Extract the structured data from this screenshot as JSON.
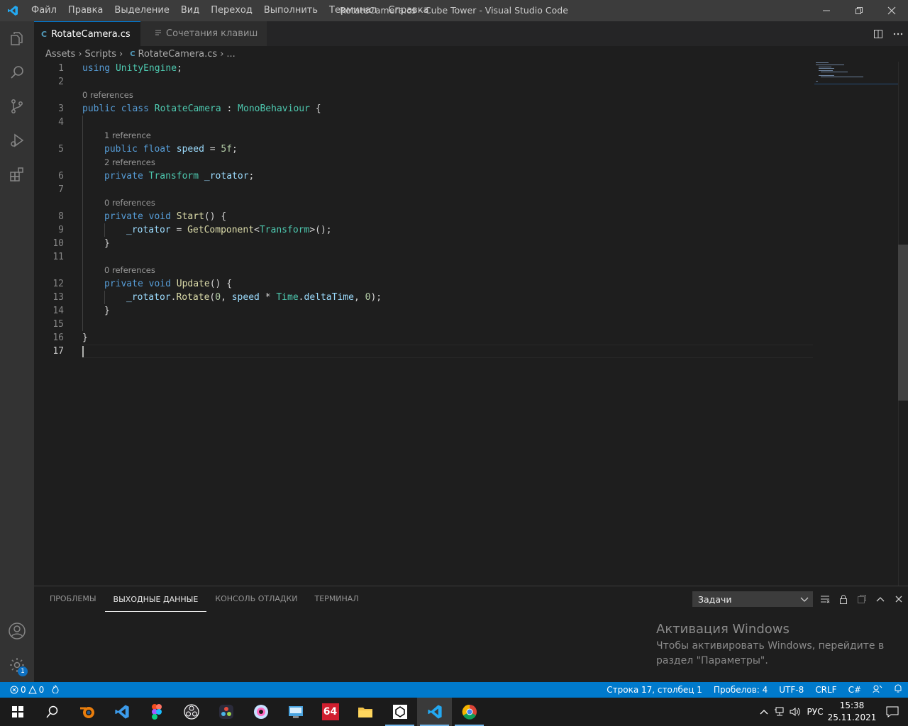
{
  "titlebar": {
    "menu": [
      "Файл",
      "Правка",
      "Выделение",
      "Вид",
      "Переход",
      "Выполнить",
      "Терминал",
      "Справка"
    ],
    "title": "RotateCamera.cs - Cube Tower - Visual Studio Code"
  },
  "tabs": [
    {
      "label": "RotateCamera.cs",
      "icon": "csharp-icon",
      "active": true
    },
    {
      "label": "Сочетания клавиш",
      "icon": "keyboard-shortcuts-icon",
      "active": false
    }
  ],
  "breadcrumb": {
    "items": [
      "Assets",
      "Scripts",
      "RotateCamera.cs",
      "..."
    ]
  },
  "editor": {
    "current_line": "17",
    "line_numbers": [
      "1",
      "2",
      "3",
      "4",
      "5",
      "6",
      "7",
      "8",
      "9",
      "10",
      "11",
      "12",
      "13",
      "14",
      "15",
      "16",
      "17"
    ],
    "codelens": {
      "class": "0 references",
      "speed": "1 reference",
      "rotator": "2 references",
      "start": "0 references",
      "update": "0 references"
    },
    "tokens": {
      "using": "using",
      "unity_engine": "UnityEngine",
      "semi": ";",
      "public": "public",
      "class": "class",
      "rotate_camera": "RotateCamera",
      "colon": " : ",
      "mono": "MonoBehaviour",
      "brace_open": " {",
      "float": "float",
      "speed": "speed",
      "eq": " = ",
      "five": "5f",
      "private": "private",
      "transform": "Transform",
      "rotator": "_rotator",
      "void": "void",
      "start": "Start",
      "parens_brace": "() {",
      "get_component": "GetComponent",
      "lt": "<",
      "gt_call": ">();",
      "close_brace": "}",
      "update": "Update",
      "dot": ".",
      "rotate": "Rotate",
      "paren_open": "(",
      "zero": "0",
      "comma": ", ",
      "star": " * ",
      "time": "Time",
      "delta": "deltaTime",
      "paren_close_semi": ");"
    }
  },
  "panel": {
    "tabs": [
      "ПРОБЛЕМЫ",
      "ВЫХОДНЫЕ ДАННЫЕ",
      "КОНСОЛЬ ОТЛАДКИ",
      "ТЕРМИНАЛ"
    ],
    "active_tab": "ВЫХОДНЫЕ ДАННЫЕ",
    "output_select": "Задачи"
  },
  "activation": {
    "title": "Активация Windows",
    "line1": "Чтобы активировать Windows, перейдите в",
    "line2": "раздел \"Параметры\"."
  },
  "status": {
    "errors": "0",
    "warnings": "0",
    "position": "Строка 17, столбец 1",
    "spaces": "Пробелов: 4",
    "encoding": "UTF-8",
    "eol": "CRLF",
    "language": "C#"
  },
  "activity": {
    "settings_badge": "1"
  },
  "taskbar": {
    "lang": "РУС",
    "time": "15:38",
    "date": "25.11.2021",
    "aida": "64"
  },
  "colors": {
    "accent": "#007acc",
    "keyword": "#569cd6",
    "type": "#4ec9b0",
    "function": "#dcdcaa",
    "variable": "#9cdcfe",
    "number": "#b5cea8"
  }
}
